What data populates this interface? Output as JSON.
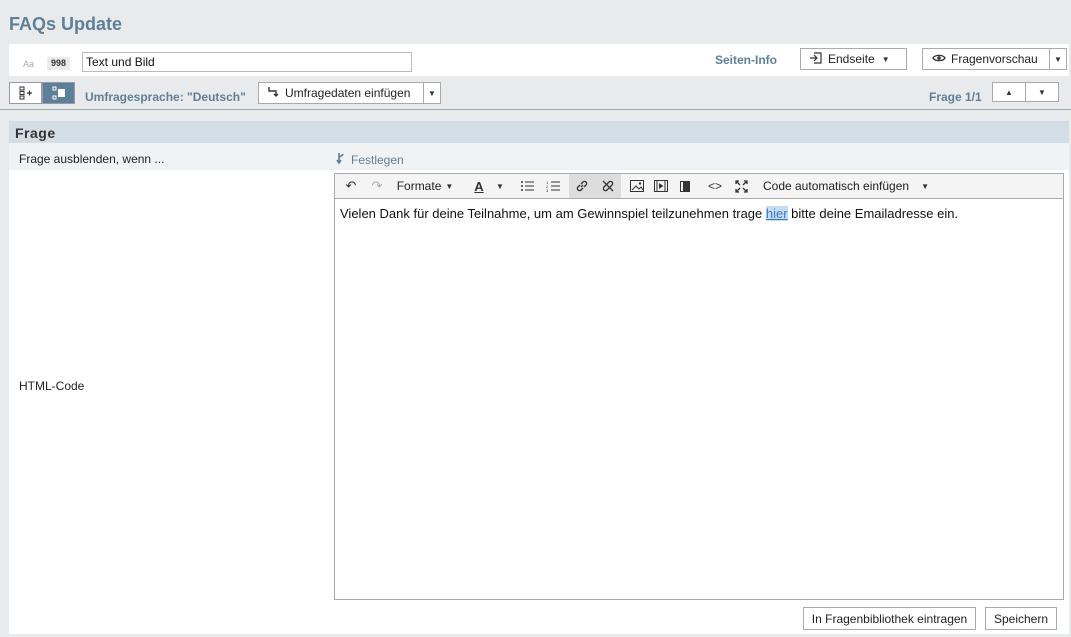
{
  "page": {
    "title": "FAQs Update"
  },
  "topbar": {
    "aa_label": "Aa",
    "question_id": "998",
    "title_value": "Text und Bild",
    "seiten_info": "Seiten-Info",
    "endseite_label": "Endseite",
    "preview_label": "Fragenvorschau"
  },
  "toolbar": {
    "language_label": "Umfragesprache: \"Deutsch\"",
    "insert_label": "Umfragedaten einfügen",
    "frage_count": "Frage 1/1"
  },
  "section": {
    "title": "Frage",
    "hide_label": "Frage ausblenden, wenn ...",
    "festlegen_label": "Festlegen",
    "html_label": "HTML-Code"
  },
  "editor": {
    "formats_label": "Formate",
    "auto_code_label": "Code automatisch einfügen",
    "text_before": "Vielen Dank für deine Teilnahme, um am Gewinnspiel teilzunehmen trage ",
    "link_text": "hier",
    "text_after": " bitte deine Emailadresse ein."
  },
  "footer": {
    "library_label": "In Fragenbibliothek eintragen",
    "save_label": "Speichern"
  }
}
